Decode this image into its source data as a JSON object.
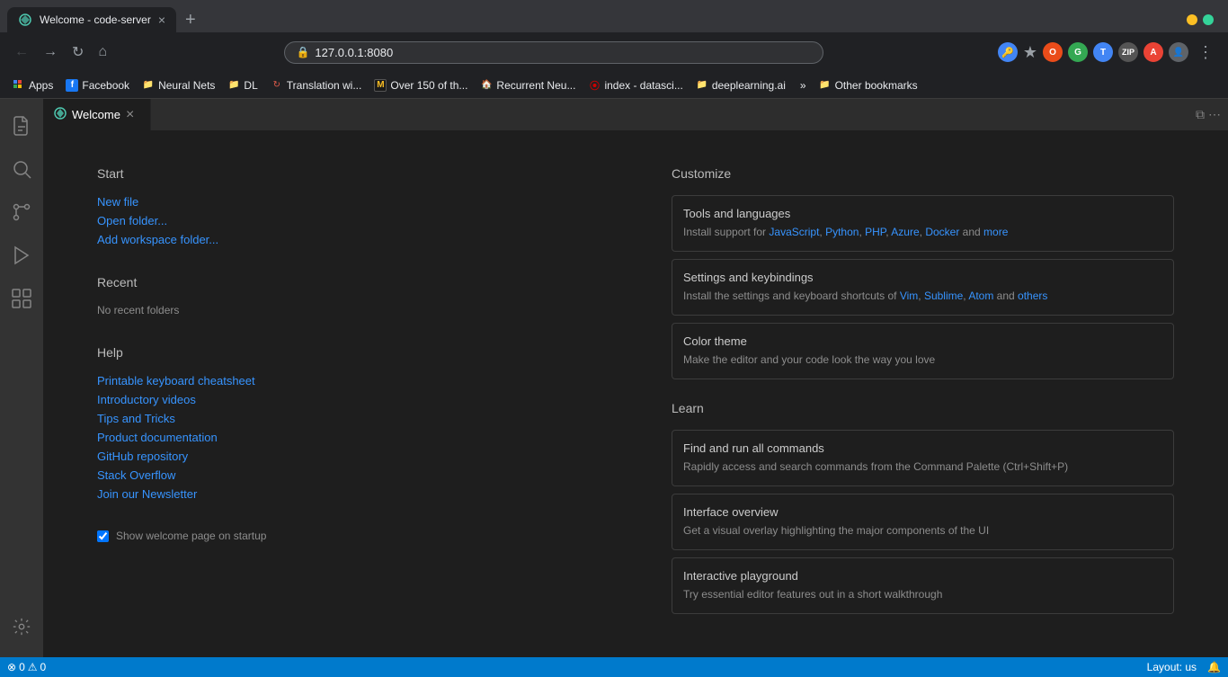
{
  "browser": {
    "tab": {
      "title": "Welcome - code-server",
      "favicon": "⬡"
    },
    "new_tab_btn": "+",
    "address": "127.0.0.1:8080",
    "traffic_lights": {
      "yellow": "#fbbf24",
      "green": "#34d399",
      "red": "#f87171"
    },
    "bookmarks": [
      {
        "label": "Apps",
        "icon_type": "apps"
      },
      {
        "label": "Facebook",
        "icon_type": "facebook"
      },
      {
        "label": "Neural Nets",
        "icon_type": "folder"
      },
      {
        "label": "DL",
        "icon_type": "folder"
      },
      {
        "label": "Translation wi...",
        "icon_type": "reload"
      },
      {
        "label": "Over 150 of th...",
        "icon_type": "m"
      },
      {
        "label": "Recurrent Neu...",
        "icon_type": "house"
      },
      {
        "label": "index - datasci...",
        "icon_type": "lastpass"
      },
      {
        "label": "deeplearning.ai",
        "icon_type": "folder"
      }
    ],
    "more_bookmarks": "»",
    "other_bookmarks": "Other bookmarks"
  },
  "vscode": {
    "tab": {
      "label": "Welcome",
      "icon": "⬡"
    },
    "welcome": {
      "start": {
        "title": "Start",
        "new_file": "New file",
        "open_folder": "Open folder...",
        "add_workspace": "Add workspace folder..."
      },
      "recent": {
        "title": "Recent",
        "empty": "No recent folders"
      },
      "help": {
        "title": "Help",
        "links": [
          "Printable keyboard cheatsheet",
          "Introductory videos",
          "Tips and Tricks",
          "Product documentation",
          "GitHub repository",
          "Stack Overflow",
          "Join our Newsletter"
        ]
      },
      "customize": {
        "title": "Customize",
        "items": [
          {
            "title": "Tools and languages",
            "desc_prefix": "Install support for ",
            "links": [
              "JavaScript",
              "Python",
              "PHP",
              "Azure",
              "Docker"
            ],
            "desc_suffix": " and ",
            "link_more": "more"
          },
          {
            "title": "Settings and keybindings",
            "desc_prefix": "Install the settings and keyboard shortcuts of ",
            "links": [
              "Vim",
              "Sublime",
              "Atom"
            ],
            "desc_suffix": " and ",
            "link_more": "others"
          },
          {
            "title": "Color theme",
            "desc": "Make the editor and your code look the way you love"
          }
        ]
      },
      "learn": {
        "title": "Learn",
        "items": [
          {
            "title": "Find and run all commands",
            "desc": "Rapidly access and search commands from the Command Palette (Ctrl+Shift+P)"
          },
          {
            "title": "Interface overview",
            "desc": "Get a visual overlay highlighting the major components of the UI"
          },
          {
            "title": "Interactive playground",
            "desc": "Try essential editor features out in a short walkthrough"
          }
        ]
      },
      "checkbox_label": "Show welcome page on startup"
    }
  },
  "status_bar": {
    "left": {
      "errors": "0",
      "warnings": "0"
    },
    "right": {
      "layout": "Layout: us",
      "bell": "🔔"
    }
  },
  "activity_bar": {
    "items": [
      {
        "icon": "⎘",
        "label": "explorer",
        "active": false
      },
      {
        "icon": "⊞",
        "label": "extensions",
        "active": false
      },
      {
        "icon": "🔍",
        "label": "search",
        "active": false
      },
      {
        "icon": "⑂",
        "label": "source-control",
        "active": false
      },
      {
        "icon": "⚙",
        "label": "debug",
        "active": false
      },
      {
        "icon": "⊡",
        "label": "extensions-2",
        "active": false
      }
    ],
    "bottom": [
      {
        "icon": "⚙",
        "label": "settings"
      }
    ]
  }
}
